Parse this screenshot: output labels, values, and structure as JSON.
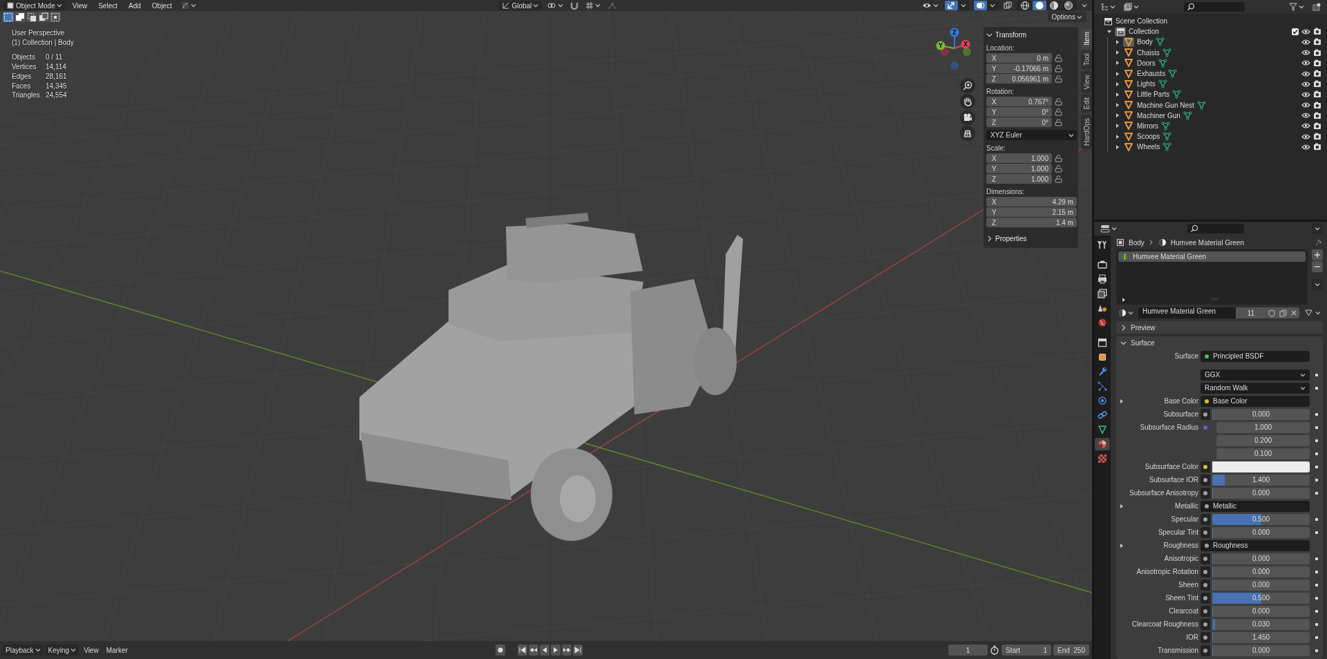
{
  "header": {
    "mode": "Object Mode",
    "menus": [
      "View",
      "Select",
      "Add",
      "Object"
    ],
    "orientation": "Global",
    "shading": [
      {
        "kind": "wire",
        "selected": false
      },
      {
        "kind": "solid",
        "selected": true
      },
      {
        "kind": "material",
        "selected": false
      },
      {
        "kind": "rendered",
        "selected": false
      }
    ]
  },
  "select_modes": [
    {
      "kind": "set",
      "selected": true
    },
    {
      "kind": "extend",
      "selected": false
    },
    {
      "kind": "subtract",
      "selected": false
    },
    {
      "kind": "invert",
      "selected": false
    },
    {
      "kind": "intersect",
      "selected": false
    }
  ],
  "options": "Options",
  "overlay": {
    "view": "User Perspective",
    "context": "(1) Collection | Body",
    "stats": [
      {
        "label": "Objects",
        "value": "0 / 11"
      },
      {
        "label": "Vertices",
        "value": "14,114"
      },
      {
        "label": "Edges",
        "value": "28,161"
      },
      {
        "label": "Faces",
        "value": "14,345"
      },
      {
        "label": "Triangles",
        "value": "24,554"
      }
    ]
  },
  "gizmo": [
    {
      "axis": "Z",
      "color": "#2e7ee0"
    },
    {
      "axis": "Y",
      "color": "#7fb82f"
    },
    {
      "axis": "X",
      "color": "#e0455a"
    }
  ],
  "sidebar": {
    "tabs": [
      {
        "label": "Item",
        "selected": true
      },
      {
        "label": "Tool",
        "selected": false
      },
      {
        "label": "View",
        "selected": false
      },
      {
        "label": "Edit",
        "selected": false
      },
      {
        "label": "HardOps",
        "selected": false
      }
    ],
    "transform": {
      "title": "Transform",
      "expanded": true,
      "groups": [
        {
          "kind": "vector",
          "label": "Location:",
          "lockable": true,
          "rows": [
            {
              "axis": "X",
              "value": "0 m"
            },
            {
              "axis": "Y",
              "value": "-0.17066 m"
            },
            {
              "axis": "Z",
              "value": "0.056961 m"
            }
          ]
        },
        {
          "kind": "vector",
          "label": "Rotation:",
          "lockable": true,
          "rows": [
            {
              "axis": "X",
              "value": "0.767°"
            },
            {
              "axis": "Y",
              "value": "0°"
            },
            {
              "axis": "Z",
              "value": "0°"
            }
          ]
        },
        {
          "kind": "dropdown",
          "value": "XYZ Euler"
        },
        {
          "kind": "vector",
          "label": "Scale:",
          "lockable": true,
          "rows": [
            {
              "axis": "X",
              "value": "1.000"
            },
            {
              "axis": "Y",
              "value": "1.000"
            },
            {
              "axis": "Z",
              "value": "1.000"
            }
          ]
        },
        {
          "kind": "vector",
          "label": "Dimensions:",
          "lockable": false,
          "rows": [
            {
              "axis": "X",
              "value": "4.29 m"
            },
            {
              "axis": "Y",
              "value": "2.15 m"
            },
            {
              "axis": "Z",
              "value": "1.4 m"
            }
          ]
        }
      ]
    },
    "properties": {
      "title": "Properties",
      "expanded": false
    }
  },
  "timeline": {
    "menus": [
      {
        "label": "Playback",
        "dropdown": true
      },
      {
        "label": "Keying",
        "dropdown": true
      },
      {
        "label": "View",
        "dropdown": false
      },
      {
        "label": "Marker",
        "dropdown": false
      }
    ],
    "frame": "1",
    "start_label": "Start",
    "start": "1",
    "end_label": "End",
    "end": "250"
  },
  "outliner": {
    "scene": "Scene Collection",
    "collection": {
      "name": "Collection",
      "expanded": true,
      "checked": true,
      "children": [
        {
          "name": "Body",
          "selected": true,
          "expanded": false
        },
        {
          "name": "Chaisis",
          "selected": false,
          "expanded": false
        },
        {
          "name": "Doors",
          "selected": false,
          "expanded": false
        },
        {
          "name": "Exhausts",
          "selected": false,
          "expanded": false
        },
        {
          "name": "Lights",
          "selected": false,
          "expanded": false
        },
        {
          "name": "Little Parts",
          "selected": false,
          "expanded": false
        },
        {
          "name": "Machine Gun Nest",
          "selected": false,
          "expanded": false
        },
        {
          "name": "Machiner Gun",
          "selected": false,
          "expanded": false
        },
        {
          "name": "Mirrors",
          "selected": false,
          "expanded": false
        },
        {
          "name": "Scoops",
          "selected": false,
          "expanded": false
        },
        {
          "name": "Wheels",
          "selected": false,
          "expanded": false
        }
      ]
    }
  },
  "properties": {
    "editor_tabs": [
      {
        "kind": "tool",
        "selected": false
      },
      {
        "kind": "render",
        "selected": false
      },
      {
        "kind": "output",
        "selected": false
      },
      {
        "kind": "view_layer",
        "selected": false
      },
      {
        "kind": "scene",
        "selected": false
      },
      {
        "kind": "world",
        "selected": false
      },
      {
        "kind": "collection",
        "selected": false
      },
      {
        "kind": "object",
        "selected": false
      },
      {
        "kind": "modifier",
        "selected": false
      },
      {
        "kind": "particles",
        "selected": false
      },
      {
        "kind": "physics",
        "selected": false
      },
      {
        "kind": "constraints",
        "selected": false
      },
      {
        "kind": "data",
        "selected": false
      },
      {
        "kind": "material",
        "selected": true
      },
      {
        "kind": "texture",
        "selected": false
      }
    ],
    "breadcrumb": [
      "Body",
      "Humvee Material Green"
    ],
    "slots": [
      {
        "name": "Humvee Material Green",
        "selected": true
      }
    ],
    "material": {
      "name": "Humvee Material Green",
      "users": "11"
    },
    "panels": [
      {
        "kind": "preview",
        "title": "Preview",
        "expanded": false
      },
      {
        "kind": "surface",
        "title": "Surface",
        "expanded": true
      }
    ],
    "shader": {
      "label": "Surface",
      "value": "Principled BSDF",
      "color": "#3fc24a"
    },
    "inputs": [
      {
        "kind": "dropdown",
        "value": "GGX"
      },
      {
        "kind": "dropdown",
        "value": "Random Walk"
      },
      {
        "kind": "link",
        "label": "Base Color",
        "value": "Base Color",
        "color": "#c7c729"
      },
      {
        "kind": "slider",
        "label": "Subsurface",
        "value": "0.000",
        "level": 0,
        "color": "#a1a1a1"
      },
      {
        "kind": "vector",
        "label": "Subsurface Radius",
        "values": [
          "1.000",
          "0.200",
          "0.100"
        ],
        "color": "#6363c7"
      },
      {
        "kind": "color",
        "label": "Subsurface Color",
        "color": "#c7c729",
        "swatch": {
          "color": "#ececec"
        }
      },
      {
        "kind": "slider",
        "label": "Subsurface IOR",
        "value": "1.400",
        "level": 0.13,
        "color": "#a1a1a1"
      },
      {
        "kind": "slider",
        "label": "Subsurface Anisotropy",
        "value": "0.000",
        "level": 0,
        "color": "#a1a1a1"
      },
      {
        "kind": "link",
        "label": "Metallic",
        "value": "Metallic",
        "color": "#a1a1a1"
      },
      {
        "kind": "slider",
        "label": "Specular",
        "value": "0.500",
        "level": 0.5,
        "color": "#a1a1a1"
      },
      {
        "kind": "slider",
        "label": "Specular Tint",
        "value": "0.000",
        "level": 0,
        "color": "#a1a1a1"
      },
      {
        "kind": "link",
        "label": "Roughness",
        "value": "Roughness",
        "color": "#a1a1a1"
      },
      {
        "kind": "slider",
        "label": "Anisotropic",
        "value": "0.000",
        "level": 0,
        "color": "#a1a1a1"
      },
      {
        "kind": "slider",
        "label": "Anisotropic Rotation",
        "value": "0.000",
        "level": 0,
        "color": "#a1a1a1"
      },
      {
        "kind": "slider",
        "label": "Sheen",
        "value": "0.000",
        "level": 0,
        "color": "#a1a1a1"
      },
      {
        "kind": "slider",
        "label": "Sheen Tint",
        "value": "0.500",
        "level": 0.5,
        "color": "#a1a1a1"
      },
      {
        "kind": "slider",
        "label": "Clearcoat",
        "value": "0.000",
        "level": 0,
        "color": "#a1a1a1"
      },
      {
        "kind": "slider",
        "label": "Clearcoat Roughness",
        "value": "0.030",
        "level": 0.03,
        "color": "#a1a1a1"
      },
      {
        "kind": "slider",
        "label": "IOR",
        "value": "1.450",
        "level": 0,
        "color": "#a1a1a1"
      },
      {
        "kind": "slider",
        "label": "Transmission",
        "value": "0.000",
        "level": 0,
        "color": "#a1a1a1"
      }
    ]
  }
}
